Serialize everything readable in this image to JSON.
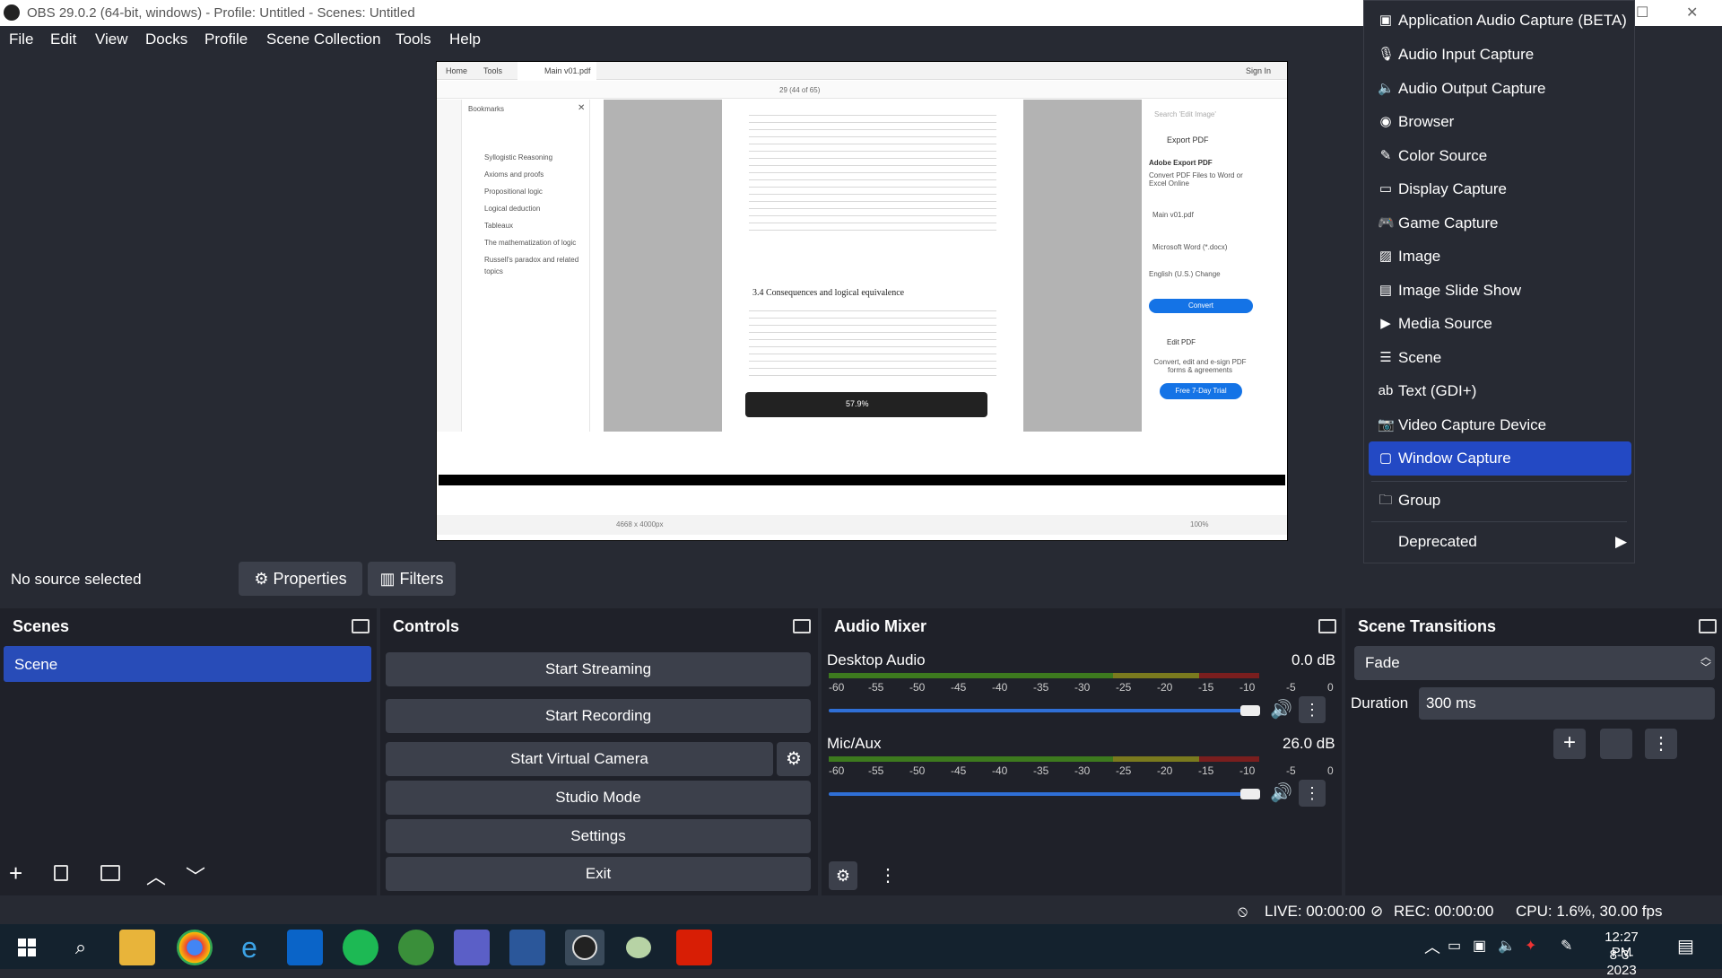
{
  "window": {
    "title": "OBS 29.0.2 (64-bit, windows) - Profile: Untitled - Scenes: Untitled"
  },
  "menu": [
    "File",
    "Edit",
    "View",
    "Docks",
    "Profile",
    "Scene Collection",
    "Tools",
    "Help"
  ],
  "preview": {
    "pdf_tabs": [
      "Home",
      "Tools",
      "Main v01.pdf"
    ],
    "signin": "Sign In",
    "page_counter": "29 (44 of 65)",
    "zoom": "57.9%",
    "bookmarks_title": "Bookmarks",
    "bookmarks": [
      "Syllogistic Reasoning",
      "Axioms and proofs",
      "Propositional logic",
      "Logical deduction",
      "Tableaux",
      "The mathematization of logic",
      "Russell's paradox and related topics"
    ],
    "section_heading": "3.4    Consequences and logical equivalence",
    "export": {
      "title": "Export PDF",
      "subtitle": "Adobe Export PDF",
      "desc": "Convert PDF Files to Word or Excel Online",
      "file": "Main v01.pdf",
      "convert_to": "Microsoft Word (*.docx)",
      "language": "English (U.S.)  Change",
      "convert_btn": "Convert",
      "edit_pdf": "Edit PDF",
      "edit_desc": "Convert, edit and e-sign PDF forms & agreements",
      "trial_btn": "Free 7-Day Trial"
    },
    "search_placeholder": "Search 'Edit Image'",
    "status_left": "4668 x 4000px",
    "status_right": "100%"
  },
  "source_bar": {
    "no_source": "No source selected",
    "properties": "Properties",
    "filters": "Filters"
  },
  "scenes": {
    "title": "Scenes",
    "items": [
      "Scene"
    ]
  },
  "controls": {
    "title": "Controls",
    "start_streaming": "Start Streaming",
    "start_recording": "Start Recording",
    "start_virtual_camera": "Start Virtual Camera",
    "studio_mode": "Studio Mode",
    "settings": "Settings",
    "exit": "Exit"
  },
  "mixer": {
    "title": "Audio Mixer",
    "channels": [
      {
        "name": "Desktop Audio",
        "db": "0.0 dB",
        "volume": 0.98
      },
      {
        "name": "Mic/Aux",
        "db": "26.0 dB",
        "volume": 0.98
      }
    ],
    "ticks": [
      "-60",
      "-55",
      "-50",
      "-45",
      "-40",
      "-35",
      "-30",
      "-25",
      "-20",
      "-15",
      "-10",
      "-5",
      "0"
    ]
  },
  "transitions": {
    "title": "Scene Transitions",
    "selected": "Fade",
    "duration_label": "Duration",
    "duration_value": "300 ms"
  },
  "context_menu": {
    "items": [
      {
        "label": "Application Audio Capture (BETA)",
        "icon": "app-audio-icon"
      },
      {
        "label": "Audio Input Capture",
        "icon": "microphone-icon"
      },
      {
        "label": "Audio Output Capture",
        "icon": "speaker-icon"
      },
      {
        "label": "Browser",
        "icon": "globe-icon"
      },
      {
        "label": "Color Source",
        "icon": "brush-icon"
      },
      {
        "label": "Display Capture",
        "icon": "monitor-icon"
      },
      {
        "label": "Game Capture",
        "icon": "gamepad-icon"
      },
      {
        "label": "Image",
        "icon": "image-icon"
      },
      {
        "label": "Image Slide Show",
        "icon": "slideshow-icon"
      },
      {
        "label": "Media Source",
        "icon": "play-icon"
      },
      {
        "label": "Scene",
        "icon": "list-icon"
      },
      {
        "label": "Text (GDI+)",
        "icon": "text-icon"
      },
      {
        "label": "Video Capture Device",
        "icon": "camera-icon"
      },
      {
        "label": "Window Capture",
        "icon": "window-icon",
        "selected": true
      },
      {
        "label": "Group",
        "icon": "folder-icon"
      },
      {
        "label": "Deprecated",
        "icon": "",
        "submenu": true
      }
    ]
  },
  "status": {
    "live": "LIVE: 00:00:00",
    "rec": "REC: 00:00:00",
    "cpu": "CPU: 1.6%, 30.00 fps"
  },
  "taskbar": {
    "time": "12:27 PM",
    "date": "8-3-2023"
  },
  "colors": {
    "bg": "#272a33",
    "panel": "#1f2129",
    "button": "#3c404b",
    "accent": "#2349c4",
    "scene_selected": "#284cb8"
  }
}
